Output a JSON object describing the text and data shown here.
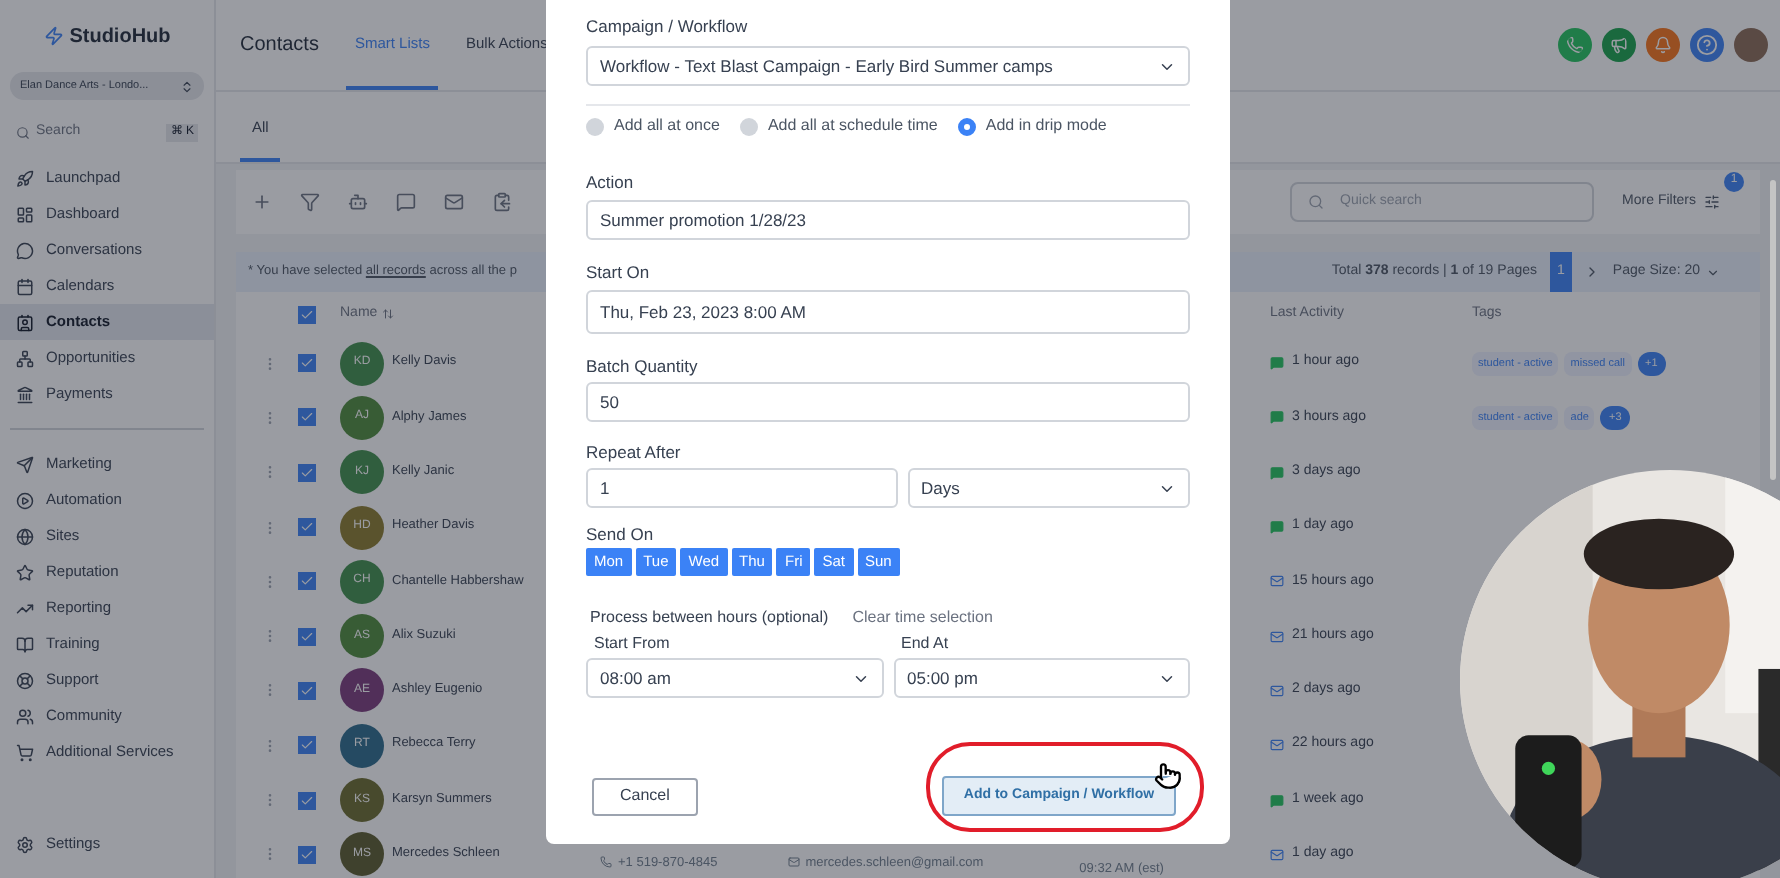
{
  "sidebar": {
    "logo": "StudioHub",
    "account": "Elan Dance Arts - Londo...",
    "search": {
      "placeholder": "Search",
      "shortcut": "⌘ K"
    },
    "items": [
      {
        "label": "Launchpad",
        "selected": false
      },
      {
        "label": "Dashboard",
        "selected": false
      },
      {
        "label": "Conversations",
        "selected": false
      },
      {
        "label": "Calendars",
        "selected": false
      },
      {
        "label": "Contacts",
        "selected": true
      },
      {
        "label": "Opportunities",
        "selected": false
      },
      {
        "label": "Payments",
        "selected": false
      }
    ],
    "items_2": [
      {
        "label": "Marketing",
        "selected": false
      },
      {
        "label": "Automation",
        "selected": false
      },
      {
        "label": "Sites",
        "selected": false
      },
      {
        "label": "Reputation",
        "selected": false
      },
      {
        "label": "Reporting",
        "selected": false
      },
      {
        "label": "Training",
        "selected": false
      },
      {
        "label": "Support",
        "selected": false
      },
      {
        "label": "Community",
        "selected": false
      },
      {
        "label": "Additional Services",
        "selected": false
      }
    ],
    "settings": "Settings"
  },
  "header": {
    "title": "Contacts",
    "tabs": [
      {
        "label": "Smart Lists",
        "selected": true
      },
      {
        "label": "Bulk Actions",
        "selected": false
      }
    ]
  },
  "subtabs": [
    {
      "label": "All",
      "selected": true
    }
  ],
  "toolbar": {
    "quick_search": {
      "placeholder": "Quick search"
    },
    "more_filters": "More Filters",
    "filter_count": "1"
  },
  "banner": {
    "before": "* You have selected ",
    "link": "all records",
    "after": " across all the p"
  },
  "pagination": {
    "summary": "Total **378** records | **1** of 19 Pages",
    "page": "1",
    "page_size": "Page Size: 20"
  },
  "table": {
    "columns": [
      "Name",
      "Last Activity",
      "Tags"
    ],
    "all_checked": true,
    "rows": [
      {
        "initials": "KD",
        "name": "Kelly Davis",
        "checked": true,
        "kind": "message",
        "activity": "1 hour ago",
        "tags": [
          "student - active",
          "missed call"
        ],
        "more": "+1"
      },
      {
        "initials": "AJ",
        "name": "Alphy James",
        "checked": true,
        "kind": "message",
        "activity": "3 hours ago",
        "tags": [
          "student - active",
          "ade"
        ],
        "more": "+3"
      },
      {
        "initials": "KJ",
        "name": "Kelly Janic",
        "checked": true,
        "kind": "message",
        "activity": "3 days ago",
        "tags": [],
        "more": ""
      },
      {
        "initials": "HD",
        "name": "Heather Davis",
        "checked": true,
        "kind": "message",
        "activity": "1 day ago",
        "tags": [],
        "more": ""
      },
      {
        "initials": "CH",
        "name": "Chantelle Habbershaw",
        "checked": true,
        "kind": "email",
        "activity": "15 hours ago",
        "tags": [],
        "more": ""
      },
      {
        "initials": "AS",
        "name": "Alix Suzuki",
        "checked": true,
        "kind": "email",
        "activity": "21 hours ago",
        "tags": [],
        "more": ""
      },
      {
        "initials": "AE",
        "name": "Ashley Eugenio",
        "checked": true,
        "kind": "email",
        "activity": "2 days ago",
        "tags": [],
        "more": ""
      },
      {
        "initials": "RT",
        "name": "Rebecca Terry",
        "checked": true,
        "kind": "email",
        "activity": "22 hours ago",
        "tags": [],
        "more": ""
      },
      {
        "initials": "KS",
        "name": "Karsyn Summers",
        "checked": true,
        "kind": "message",
        "activity": "1 week ago",
        "tags": [],
        "more": ""
      },
      {
        "initials": "MS",
        "name": "Mercedes Schleen",
        "checked": true,
        "kind": "email",
        "activity": "1 day ago",
        "tags": [],
        "more": ""
      }
    ],
    "contact_line": {
      "phone": "+1 519-870-4845",
      "email": "mercedes.schleen@gmail.com",
      "time": "09:32 AM (est)"
    }
  },
  "modal": {
    "campaign": {
      "label": "Campaign / Workflow",
      "value": "Workflow - Text Blast Campaign - Early Bird Summer camps"
    },
    "modes": [
      {
        "label": "Add all at once",
        "selected": false
      },
      {
        "label": "Add all at schedule time",
        "selected": false
      },
      {
        "label": "Add in drip mode",
        "selected": true
      }
    ],
    "action": {
      "label": "Action",
      "value": "Summer promotion 1/28/23"
    },
    "start_on": {
      "label": "Start On",
      "value": "Thu, Feb 23, 2023 8:00 AM"
    },
    "batch": {
      "label": "Batch Quantity",
      "value": "50"
    },
    "repeat": {
      "label": "Repeat After",
      "value": "1",
      "unit": "Days"
    },
    "send_on": {
      "label": "Send On",
      "days": [
        {
          "label": "Mon",
          "selected": true
        },
        {
          "label": "Tue",
          "selected": true
        },
        {
          "label": "Wed",
          "selected": true
        },
        {
          "label": "Thu",
          "selected": true
        },
        {
          "label": "Fri",
          "selected": true
        },
        {
          "label": "Sat",
          "selected": true
        },
        {
          "label": "Sun",
          "selected": true
        }
      ]
    },
    "hours": {
      "label": "Process between hours (optional)",
      "clear": "Clear time selection",
      "start_label": "Start From",
      "start": "08:00 am",
      "end_label": "End At",
      "end": "05:00 pm"
    },
    "cancel": "Cancel",
    "submit": "Add to Campaign / Workflow"
  }
}
